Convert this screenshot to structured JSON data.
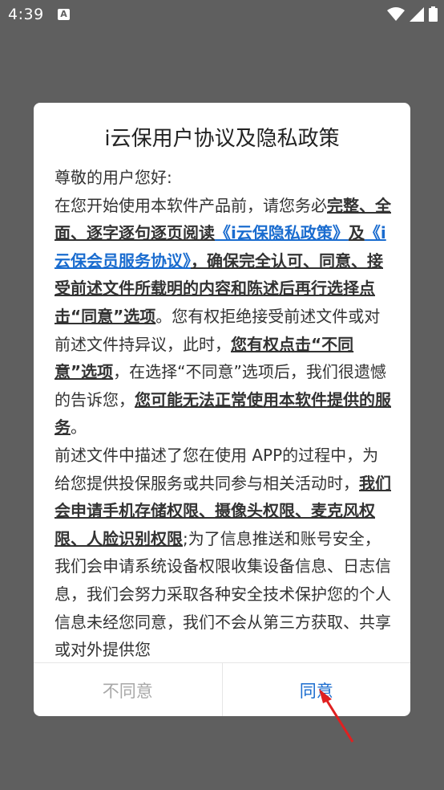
{
  "status_bar": {
    "time": "4:39",
    "notification_letter": "A",
    "icons": [
      "wifi-icon",
      "signal-icon",
      "battery-icon"
    ]
  },
  "dialog": {
    "title": "i云保用户协议及隐私政策",
    "greeting": "尊敬的用户您好:",
    "p1_a": "在您开始使用本软件产品前，请您务必",
    "p1_b": "完整、全面、逐字逐句逐页阅读",
    "p1_link1": "《i云保隐私政策》",
    "p1_c": "及",
    "p1_link2": "《i云保会员服务协议》",
    "p1_d": "，确保完全认可、同意、接受前述文件所载明的内容和陈述后再行选择点击“同意”选项",
    "p1_e": "。您有权拒绝接受前述文件或对前述文件持异议，此时，",
    "p1_f": "您有权点击“不同意”选项",
    "p1_g": "，在选择“不同意”选项后，我们很遗憾的告诉您，",
    "p1_h": "您可能无法正常使用本软件提供的服务",
    "p1_i": "。",
    "p2_a": "前述文件中描述了您在使用 APP的过程中，为给您提供投保服务或共同参与相关活动时，",
    "p2_b": "我们会申请手机存储权限、摄像头权限、麦克风权限、人脸识别权限",
    "p2_c": ";为了信息推送和账号安全，我们会申请系统设备权限收集设备信息、日志信息，我们会努力采取各种安全技术保护您的个人信息未经您同意，我们不会从第三方获取、共享或对外提供您"
  },
  "buttons": {
    "disagree": "不同意",
    "agree": "同意"
  },
  "colors": {
    "accent": "#1a6ccf",
    "overlay": "#5f5f5f",
    "annotation_arrow": "#e02020"
  }
}
